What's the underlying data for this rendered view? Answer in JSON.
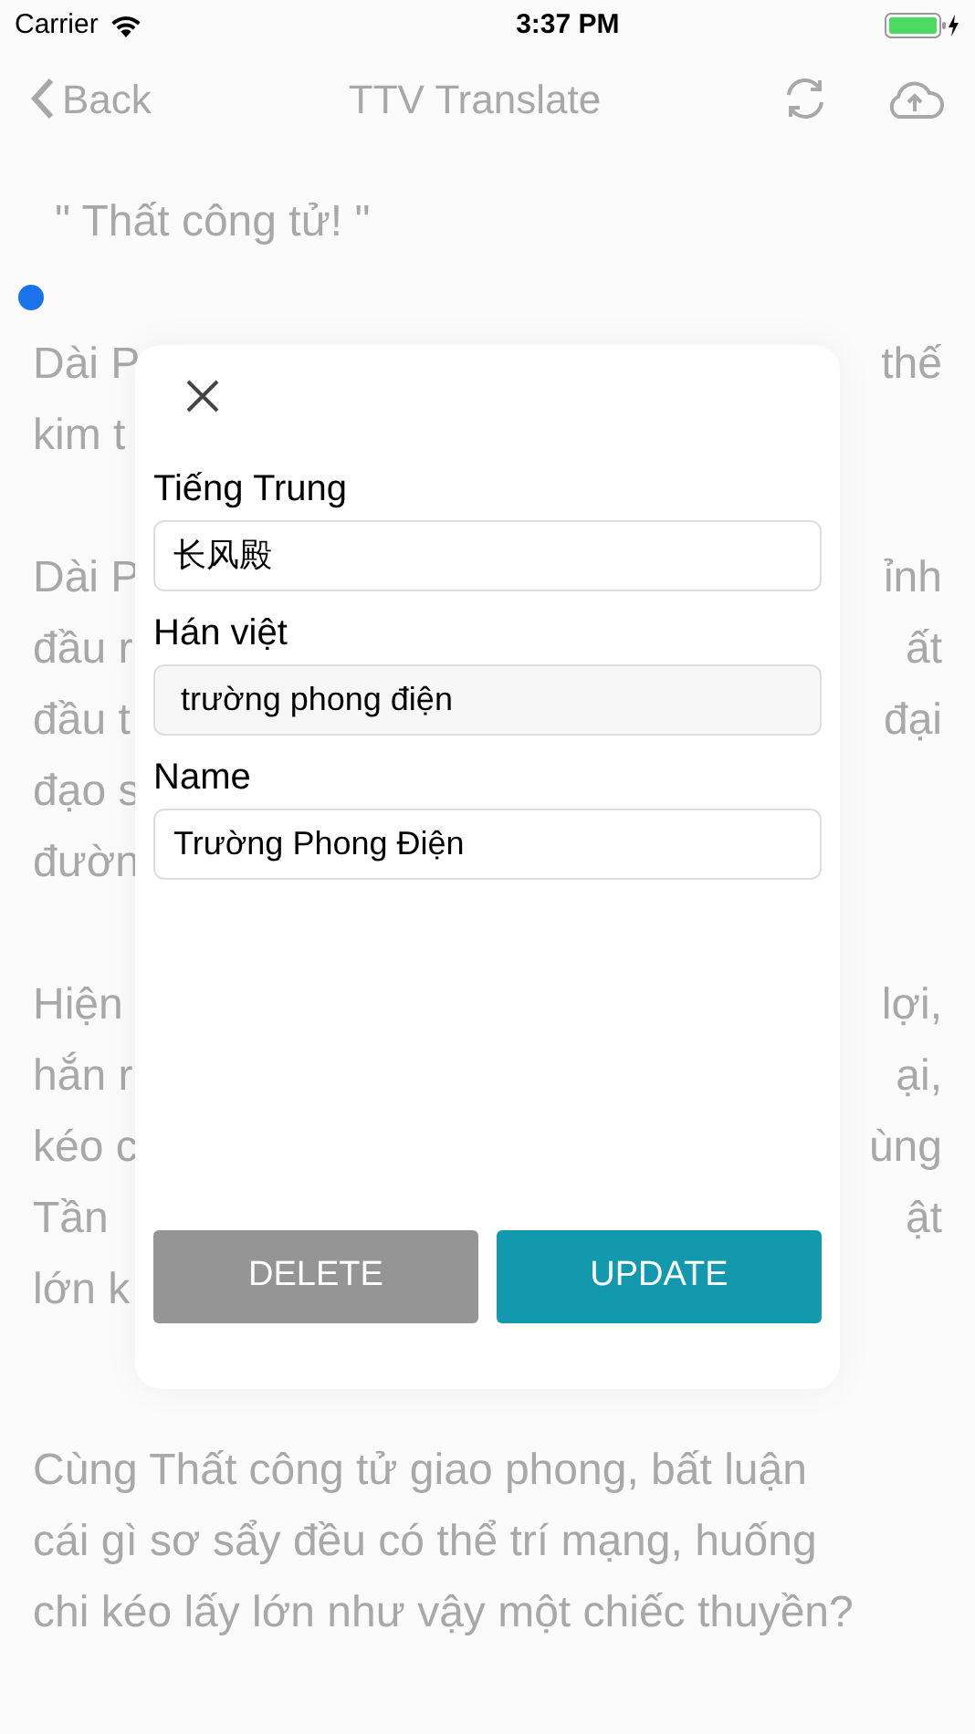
{
  "status_bar": {
    "carrier": "Carrier",
    "time": "3:37 PM"
  },
  "nav_bar": {
    "back": "Back",
    "title": "TTV Translate"
  },
  "background": {
    "quote": "\" Thất công tử! \"",
    "paragraphs": [
      [
        {
          "left": "Dài P",
          "right": "thế"
        },
        {
          "left": "kim t"
        }
      ],
      [
        {
          "left": "Dài P",
          "right": "ỉnh"
        },
        {
          "left": "đầu r",
          "right": "ất"
        },
        {
          "left": "đầu t",
          "right": "đại"
        },
        {
          "left": "đạo s"
        },
        {
          "left": "đườn"
        }
      ],
      [
        {
          "left": "Hiện",
          "right": "lợi,"
        },
        {
          "left": "hắn r",
          "right": "ại,"
        },
        {
          "left": "kéo c",
          "right": "ùng"
        },
        {
          "left": "Tần",
          "right": "ật"
        },
        {
          "left": "lớn k"
        }
      ]
    ],
    "paragraph": [
      "Cùng Thất công tử giao phong, bất luận",
      "cái gì sơ sẩy đều có thể trí mạng, huống",
      "chi kéo lấy lớn như vậy một chiếc thuyền?"
    ]
  },
  "dialog": {
    "fields": [
      {
        "label": "Tiếng Trung",
        "value": "长风殿",
        "disabled": false
      },
      {
        "label": "Hán việt",
        "value": "trường phong điện",
        "disabled": true
      },
      {
        "label": "Name",
        "value": "Trường Phong Điện",
        "disabled": false
      }
    ],
    "buttons": [
      {
        "label": "DELETE",
        "kind": "secondary"
      },
      {
        "label": "UPDATE",
        "kind": "primary"
      }
    ]
  }
}
